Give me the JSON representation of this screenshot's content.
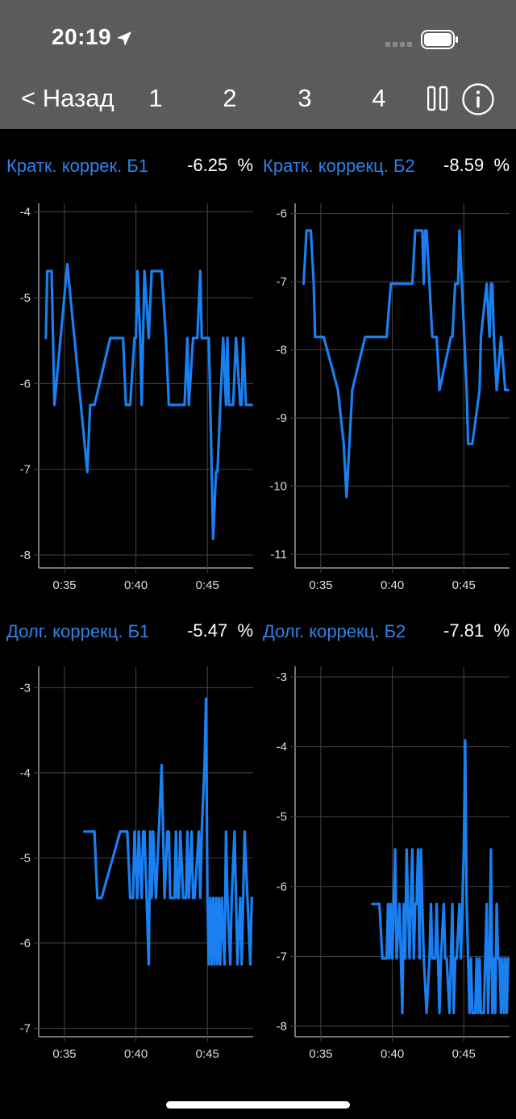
{
  "status_bar": {
    "time": "20:19"
  },
  "nav": {
    "back_label": "< Назад",
    "tabs": [
      "1",
      "2",
      "3",
      "4"
    ],
    "pause_icon": "pause-icon",
    "info_icon": "info-icon"
  },
  "panels": [
    {
      "title": "Кратк. коррек. Б1",
      "value": "-6.25",
      "unit": "%"
    },
    {
      "title": "Кратк. коррекц. Б2",
      "value": "-8.59",
      "unit": "%"
    },
    {
      "title": "Долг. коррекц. Б1",
      "value": "-5.47",
      "unit": "%"
    },
    {
      "title": "Долг. коррекц. Б2",
      "value": "-7.81",
      "unit": "%"
    }
  ],
  "colors": {
    "accent": "#2f82e8",
    "line": "#1a7ff0",
    "header": "#5b5b5b",
    "grid": "#444444"
  },
  "chart_data": [
    {
      "type": "line",
      "title": "Кратк. коррек. Б1",
      "x_ticks": [
        "0:35",
        "0:40",
        "0:45"
      ],
      "x_tick_minutes": [
        35,
        40,
        45
      ],
      "xlim": [
        33.2,
        48.2
      ],
      "ylim": [
        -8.15,
        -3.9
      ],
      "y_ticks": [
        -4,
        -5,
        -6,
        -7,
        -8
      ],
      "series": [
        {
          "x": [
            33.7,
            33.8,
            34.1,
            34.3,
            35.2,
            36.6,
            36.8,
            37.1,
            38.2,
            39.1,
            39.3,
            39.6,
            39.9,
            40.0,
            40.1,
            40.3,
            40.4,
            40.6,
            40.9,
            41.1,
            41.8,
            42.1,
            42.3,
            43.4,
            43.6,
            43.7,
            44.0,
            44.3,
            44.5,
            44.6,
            45.1,
            45.3,
            45.4,
            45.6,
            45.7,
            45.9,
            46.1,
            46.3,
            46.4,
            46.5,
            46.6,
            46.8,
            47.0,
            47.3,
            47.4,
            47.5,
            47.7,
            47.8,
            48.1
          ],
          "y": [
            -5.47,
            -4.69,
            -4.69,
            -6.25,
            -4.61,
            -7.03,
            -6.25,
            -6.25,
            -5.47,
            -5.47,
            -6.25,
            -6.25,
            -5.47,
            -5.47,
            -4.69,
            -5.47,
            -6.25,
            -4.69,
            -5.47,
            -4.69,
            -4.69,
            -5.47,
            -6.25,
            -6.25,
            -5.47,
            -6.25,
            -5.47,
            -5.47,
            -4.69,
            -5.47,
            -5.47,
            -7.03,
            -7.81,
            -7.03,
            -7.03,
            -6.25,
            -5.47,
            -6.25,
            -5.47,
            -6.25,
            -6.25,
            -6.25,
            -5.47,
            -6.25,
            -6.25,
            -5.47,
            -6.25,
            -6.25,
            -6.25
          ]
        }
      ]
    },
    {
      "type": "line",
      "title": "Кратк. коррекц. Б2",
      "x_ticks": [
        "0:35",
        "0:40",
        "0:45"
      ],
      "x_tick_minutes": [
        35,
        40,
        45
      ],
      "xlim": [
        33.2,
        48.2
      ],
      "ylim": [
        -11.2,
        -5.85
      ],
      "y_ticks": [
        -6,
        -7,
        -8,
        -9,
        -10,
        -11
      ],
      "series": [
        {
          "x": [
            33.8,
            34.0,
            34.3,
            34.5,
            34.6,
            35.2,
            36.2,
            36.6,
            36.8,
            37.0,
            37.2,
            38.1,
            39.6,
            39.9,
            41.4,
            41.6,
            42.1,
            42.2,
            42.3,
            42.4,
            42.6,
            42.8,
            43.1,
            43.3,
            44.1,
            44.2,
            44.4,
            44.6,
            44.7,
            45.2,
            45.3,
            45.4,
            45.6,
            46.1,
            46.2,
            46.6,
            46.8,
            46.9,
            47.0,
            47.1,
            47.3,
            47.6,
            47.9,
            48.1
          ],
          "y": [
            -7.03,
            -6.25,
            -6.25,
            -7.03,
            -7.81,
            -7.81,
            -8.59,
            -9.38,
            -10.16,
            -9.38,
            -8.59,
            -7.81,
            -7.81,
            -7.03,
            -7.03,
            -6.25,
            -6.25,
            -7.03,
            -6.25,
            -6.25,
            -7.03,
            -7.81,
            -7.81,
            -8.59,
            -7.81,
            -7.81,
            -7.03,
            -7.03,
            -6.25,
            -8.59,
            -9.38,
            -9.38,
            -9.38,
            -8.59,
            -7.81,
            -7.03,
            -7.81,
            -7.03,
            -7.03,
            -7.81,
            -8.59,
            -7.81,
            -8.59,
            -8.59
          ]
        }
      ]
    },
    {
      "type": "line",
      "title": "Долг. коррекц. Б1",
      "x_ticks": [
        "0:35",
        "0:40",
        "0:45"
      ],
      "x_tick_minutes": [
        35,
        40,
        45
      ],
      "xlim": [
        33.2,
        48.2
      ],
      "ylim": [
        -7.1,
        -2.75
      ],
      "y_ticks": [
        -3,
        -4,
        -5,
        -6,
        -7
      ],
      "series": [
        {
          "x": [
            36.4,
            36.6,
            37.1,
            37.3,
            37.6,
            38.9,
            39.4,
            39.6,
            39.8,
            39.9,
            40.1,
            40.2,
            40.4,
            40.5,
            40.6,
            40.9,
            41.0,
            41.1,
            41.2,
            41.4,
            41.6,
            41.8,
            41.9,
            42.0,
            42.2,
            42.3,
            42.4,
            42.7,
            42.8,
            42.9,
            43.0,
            43.1,
            43.3,
            43.5,
            43.6,
            43.7,
            43.9,
            44.0,
            44.1,
            44.4,
            44.5,
            44.6,
            44.8,
            44.9,
            45.0,
            45.1,
            45.2,
            45.3,
            45.4,
            45.5,
            45.6,
            45.7,
            45.8,
            45.9,
            46.0,
            46.2,
            46.3,
            46.4,
            46.6,
            46.7,
            46.9,
            47.1,
            47.3,
            47.4,
            47.6,
            47.8,
            48.0,
            48.1
          ],
          "y": [
            -4.69,
            -4.69,
            -4.69,
            -5.47,
            -5.47,
            -4.69,
            -4.69,
            -5.47,
            -5.47,
            -4.69,
            -5.47,
            -4.69,
            -5.47,
            -4.69,
            -4.69,
            -6.25,
            -4.69,
            -5.47,
            -4.69,
            -5.47,
            -4.69,
            -3.91,
            -4.69,
            -5.47,
            -4.69,
            -4.69,
            -5.47,
            -5.47,
            -4.69,
            -5.47,
            -5.47,
            -4.69,
            -5.47,
            -5.47,
            -4.69,
            -5.47,
            -4.69,
            -5.47,
            -5.47,
            -4.69,
            -5.47,
            -4.69,
            -3.91,
            -3.13,
            -5.47,
            -6.25,
            -5.47,
            -6.25,
            -5.47,
            -6.25,
            -5.47,
            -6.25,
            -5.47,
            -6.25,
            -5.47,
            -6.25,
            -4.69,
            -5.47,
            -6.25,
            -5.47,
            -4.69,
            -6.25,
            -5.47,
            -6.25,
            -4.69,
            -5.47,
            -6.25,
            -5.47
          ]
        }
      ]
    },
    {
      "type": "line",
      "title": "Долг. коррекц. Б2",
      "x_ticks": [
        "0:35",
        "0:40",
        "0:45"
      ],
      "x_tick_minutes": [
        35,
        40,
        45
      ],
      "xlim": [
        33.2,
        48.2
      ],
      "ylim": [
        -8.15,
        -2.85
      ],
      "y_ticks": [
        -3,
        -4,
        -5,
        -6,
        -7,
        -8
      ],
      "series": [
        {
          "x": [
            38.6,
            39.1,
            39.3,
            39.6,
            39.7,
            39.8,
            39.9,
            40.0,
            40.1,
            40.2,
            40.3,
            40.5,
            40.6,
            40.7,
            40.8,
            40.9,
            41.0,
            41.1,
            41.2,
            41.3,
            41.4,
            41.5,
            41.6,
            41.7,
            41.8,
            41.9,
            42.0,
            42.1,
            42.2,
            42.4,
            42.6,
            42.7,
            42.8,
            43.0,
            43.1,
            43.2,
            43.3,
            43.4,
            43.6,
            43.7,
            43.8,
            44.0,
            44.1,
            44.2,
            44.3,
            44.4,
            44.5,
            44.7,
            44.8,
            45.0,
            45.1,
            45.2,
            45.3,
            45.4,
            45.5,
            45.6,
            45.7,
            45.8,
            45.9,
            46.0,
            46.1,
            46.2,
            46.3,
            46.4,
            46.5,
            46.6,
            46.7,
            46.8,
            46.9,
            47.0,
            47.1,
            47.2,
            47.3,
            47.4,
            47.5,
            47.6,
            47.7,
            47.8,
            47.9,
            48.0,
            48.1
          ],
          "y": [
            -6.25,
            -6.25,
            -7.03,
            -7.03,
            -6.25,
            -7.03,
            -6.25,
            -7.03,
            -6.25,
            -5.47,
            -7.03,
            -6.25,
            -7.03,
            -7.81,
            -6.25,
            -7.03,
            -5.47,
            -6.25,
            -7.03,
            -6.25,
            -5.47,
            -7.03,
            -6.25,
            -6.25,
            -5.47,
            -7.03,
            -5.47,
            -6.25,
            -7.03,
            -7.81,
            -7.03,
            -6.25,
            -7.03,
            -7.03,
            -6.25,
            -7.03,
            -7.81,
            -7.03,
            -6.25,
            -7.03,
            -7.03,
            -7.81,
            -7.03,
            -6.25,
            -7.81,
            -7.03,
            -7.03,
            -6.25,
            -7.03,
            -5.47,
            -3.91,
            -6.25,
            -7.03,
            -7.81,
            -7.03,
            -7.81,
            -7.81,
            -7.81,
            -7.03,
            -7.81,
            -7.03,
            -7.81,
            -7.81,
            -7.81,
            -7.03,
            -6.25,
            -7.81,
            -7.03,
            -5.47,
            -7.81,
            -7.03,
            -7.81,
            -6.25,
            -7.03,
            -7.03,
            -7.81,
            -7.03,
            -7.81,
            -7.03,
            -7.81,
            -7.03
          ]
        }
      ]
    }
  ]
}
